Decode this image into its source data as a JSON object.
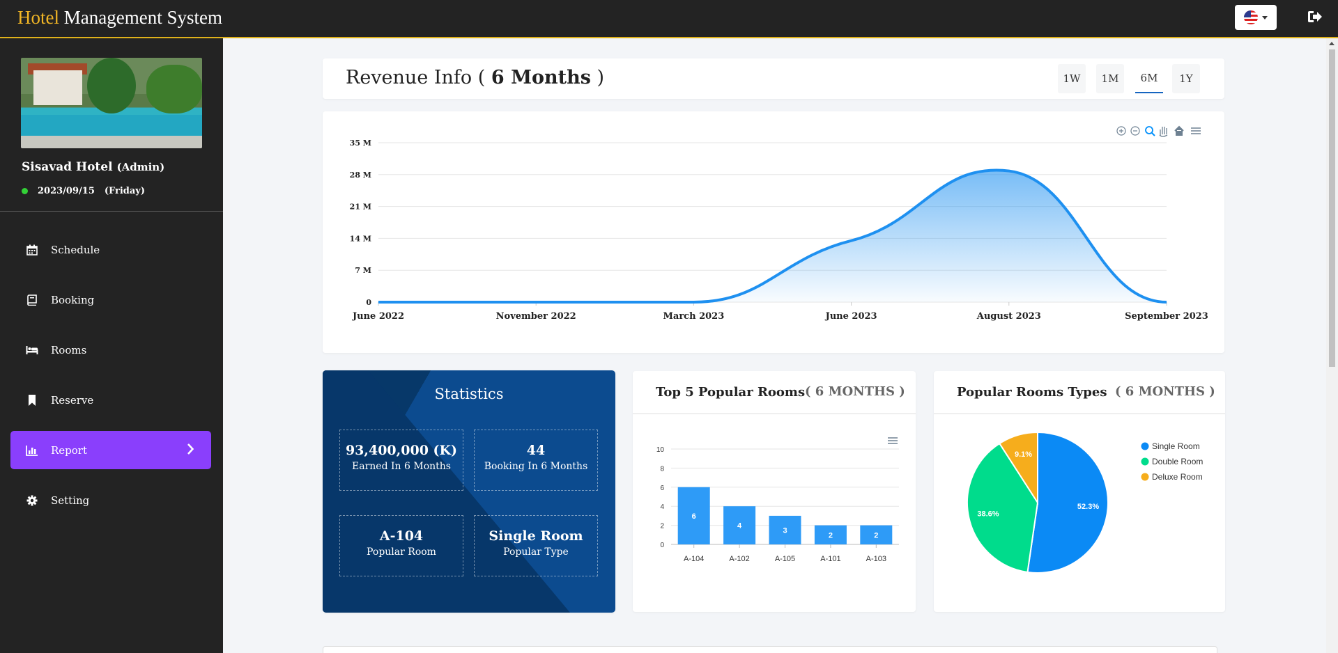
{
  "header": {
    "brand_accent": "Hotel",
    "brand_rest": " Management System",
    "language_icon": "us-flag-icon",
    "logout_icon": "sign-out-icon"
  },
  "sidebar": {
    "hotel_name": "Sisavad Hotel",
    "role": "(Admin)",
    "date": "2023/09/15",
    "day": "(Friday)",
    "items": [
      {
        "label": "Schedule",
        "icon": "calendar-icon"
      },
      {
        "label": "Booking",
        "icon": "book-icon"
      },
      {
        "label": "Rooms",
        "icon": "bed-icon"
      },
      {
        "label": "Reserve",
        "icon": "bookmark-icon"
      },
      {
        "label": "Report",
        "icon": "bar-chart-icon",
        "active": true
      },
      {
        "label": "Setting",
        "icon": "gear-icon"
      }
    ]
  },
  "revenue": {
    "title_prefix": "Revenue Info ( ",
    "title_bold": "6 Months",
    "title_suffix": " )",
    "ranges": [
      "1W",
      "1M",
      "6M",
      "1Y"
    ],
    "selected_range": "6M"
  },
  "chart_data": [
    {
      "type": "area",
      "x": [
        "June 2022",
        "November 2022",
        "March 2023",
        "June 2023",
        "August 2023",
        "September 2023"
      ],
      "values": [
        0,
        0,
        0,
        13.5,
        28.8,
        0
      ],
      "y_ticks": [
        "0",
        "7 M",
        "14 M",
        "21 M",
        "28 M",
        "35 M"
      ],
      "ylim": [
        0,
        35
      ],
      "color": "#1e90f0",
      "grid": true
    },
    {
      "type": "bar",
      "categories": [
        "A-104",
        "A-102",
        "A-105",
        "A-101",
        "A-103"
      ],
      "values": [
        6,
        4,
        3,
        2,
        2
      ],
      "y_ticks": [
        "0",
        "2",
        "4",
        "6",
        "8",
        "10"
      ],
      "ylim": [
        0,
        10
      ],
      "color": "#2e9bf7"
    },
    {
      "type": "pie",
      "slices": [
        {
          "label": "Single Room",
          "value": 52.3,
          "text": "52.3%",
          "color": "#0b8af5"
        },
        {
          "label": "Double Room",
          "value": 38.6,
          "text": "38.6%",
          "color": "#00dc8c"
        },
        {
          "label": "Deluxe Room",
          "value": 9.1,
          "text": "9.1%",
          "color": "#f6ad1c"
        }
      ],
      "legend": "right"
    }
  ],
  "statistics": {
    "title": "Statistics",
    "boxes": [
      {
        "value": "93,400,000 (K)",
        "label": "Earned In 6 Months"
      },
      {
        "value": "44",
        "label": "Booking In 6 Months"
      },
      {
        "value": "A-104",
        "label": "Popular Room"
      },
      {
        "value": "Single Room",
        "label": "Popular Type"
      }
    ]
  },
  "popular_rooms": {
    "title": "Top 5 Popular Rooms",
    "subtitle": "( 6 MONTHS )"
  },
  "popular_types": {
    "title": "Popular Rooms Types",
    "subtitle": "( 6 MONTHS )"
  }
}
